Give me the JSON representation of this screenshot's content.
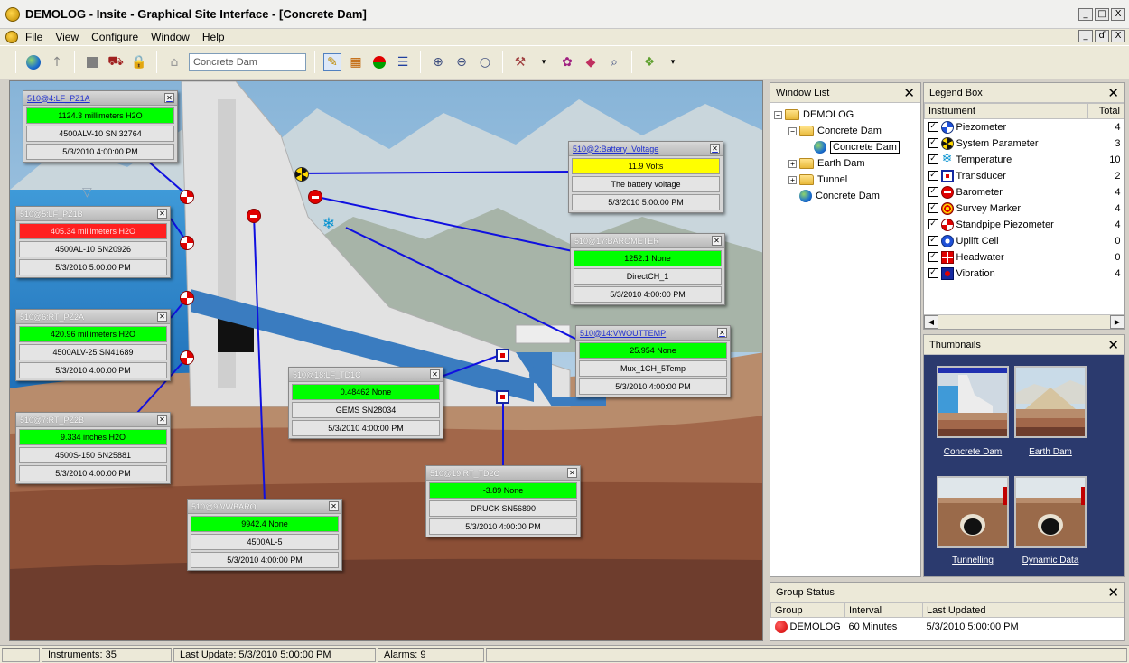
{
  "window": {
    "title": "DEMOLOG - Insite - Graphical Site Interface - [Concrete Dam]",
    "min": "_",
    "max": "□",
    "close": "X",
    "mdi_restore": "ɗ"
  },
  "menu": {
    "items": [
      "File",
      "View",
      "Configure",
      "Window",
      "Help"
    ]
  },
  "toolbar": {
    "site_input_value": "Concrete Dam"
  },
  "canvas": {
    "instruments": [
      {
        "id": "510@4:LF_PZ1A",
        "link": true,
        "value": "1124.3 millimeters H2O",
        "value_state": "green",
        "serial": "4500ALV-10 SN 32764",
        "timestamp": "5/3/2010 4:00:00 PM"
      },
      {
        "id": "510@5:LF_PZ1B",
        "link": false,
        "value": "405.34 millimeters H2O",
        "value_state": "red",
        "serial": "4500AL-10 SN20926",
        "timestamp": "5/3/2010 5:00:00 PM"
      },
      {
        "id": "510@6:RT_PZ2A",
        "link": false,
        "value": "420.96 millimeters H2O",
        "value_state": "green",
        "serial": "4500ALV-25 SN41689",
        "timestamp": "5/3/2010 4:00:00 PM"
      },
      {
        "id": "510@7:RT_PZ2B",
        "link": false,
        "value": "9.334 inches H2O",
        "value_state": "green",
        "serial": "4500S-150 SN25881",
        "timestamp": "5/3/2010 4:00:00 PM"
      },
      {
        "id": "510@9:VWBARO",
        "link": false,
        "value": "9942.4 None",
        "value_state": "green",
        "serial": "4500AL-5",
        "timestamp": "5/3/2010 4:00:00 PM"
      },
      {
        "id": "510@18:LF_TD1C",
        "link": false,
        "value": "0.48462 None",
        "value_state": "green",
        "serial": "GEMS SN28034",
        "timestamp": "5/3/2010 4:00:00 PM"
      },
      {
        "id": "510@19:RT_TD2C",
        "link": false,
        "value": "-3.89 None",
        "value_state": "green",
        "serial": "DRUCK SN56890",
        "timestamp": "5/3/2010 4:00:00 PM"
      },
      {
        "id": "510@2:Battery_Voltage",
        "link": true,
        "value": "11.9 Volts",
        "value_state": "yellow",
        "serial": "The battery voltage",
        "timestamp": "5/3/2010 5:00:00 PM"
      },
      {
        "id": "510@17:BAROMETER",
        "link": false,
        "value": "1252.1 None",
        "value_state": "green",
        "serial": "DirectCH_1",
        "timestamp": "5/3/2010 4:00:00 PM"
      },
      {
        "id": "510@14:VWOUTTEMP",
        "link": true,
        "value": "25.954 None",
        "value_state": "green",
        "serial": "Mux_1CH_5Temp",
        "timestamp": "5/3/2010 4:00:00 PM"
      }
    ]
  },
  "window_list": {
    "title": "Window List",
    "tree": [
      {
        "label": "DEMOLOG",
        "kind": "folder",
        "level": 0,
        "expander": "−"
      },
      {
        "label": "Concrete Dam",
        "kind": "folder",
        "level": 1,
        "expander": "−"
      },
      {
        "label": "Concrete Dam",
        "kind": "globe",
        "level": 2,
        "selected": true
      },
      {
        "label": "Earth Dam",
        "kind": "folder",
        "level": 1,
        "expander": "+"
      },
      {
        "label": "Tunnel",
        "kind": "folder",
        "level": 1,
        "expander": "+"
      },
      {
        "label": "Concrete Dam",
        "kind": "globe",
        "level": 1
      }
    ]
  },
  "legend": {
    "title": "Legend Box",
    "col_instrument": "Instrument",
    "col_total": "Total",
    "rows": [
      {
        "name": "Piezometer",
        "icon": "piezometer-icon",
        "total": "4"
      },
      {
        "name": "System Parameter",
        "icon": "system-parameter-icon",
        "total": "3"
      },
      {
        "name": "Temperature",
        "icon": "temperature-icon",
        "total": "10"
      },
      {
        "name": "Transducer",
        "icon": "transducer-icon",
        "total": "2"
      },
      {
        "name": "Barometer",
        "icon": "barometer-icon",
        "total": "4"
      },
      {
        "name": "Survey Marker",
        "icon": "survey-marker-icon",
        "total": "4"
      },
      {
        "name": "Standpipe Piezometer",
        "icon": "standpipe-piezometer-icon",
        "total": "4"
      },
      {
        "name": "Uplift Cell",
        "icon": "uplift-cell-icon",
        "total": "0"
      },
      {
        "name": "Headwater",
        "icon": "headwater-icon",
        "total": "0"
      },
      {
        "name": "Vibration",
        "icon": "vibration-icon",
        "total": "4"
      }
    ]
  },
  "thumbnails": {
    "title": "Thumbnails",
    "items": [
      "Concrete Dam",
      "Earth Dam",
      "Tunnelling",
      "Dynamic Data"
    ]
  },
  "group_status": {
    "title": "Group Status",
    "col_group": "Group",
    "col_interval": "Interval",
    "col_last": "Last Updated",
    "row": {
      "group": "DEMOLOG",
      "interval": "60 Minutes",
      "last": "5/3/2010 5:00:00 PM"
    }
  },
  "status_bar": {
    "instruments": "Instruments: 35",
    "last_update": "Last Update: 5/3/2010 5:00:00 PM",
    "alarms": "Alarms: 9"
  },
  "colors": {
    "ok": "#00ff00",
    "warn": "#ffff00",
    "alarm": "#ff2020",
    "thumb_bg": "#2b3a6e"
  }
}
